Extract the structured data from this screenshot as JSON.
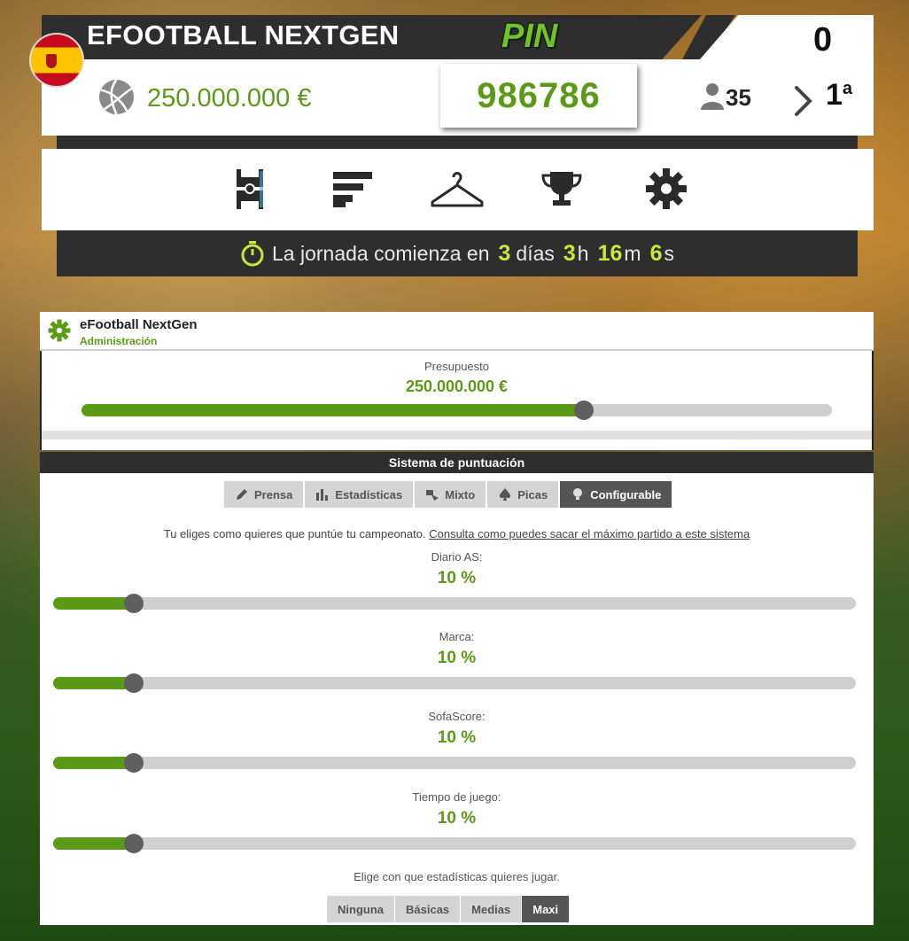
{
  "header": {
    "team_name": "EFOOTBALL NEXTGEN",
    "pin_label": "PIN",
    "points": "0",
    "budget": "250.000.000 €",
    "pin_code": "986786",
    "players_count": "35",
    "rank_number": "1",
    "rank_suffix": "a",
    "flag": "spain-flag"
  },
  "nav": {
    "items": [
      {
        "name": "lineup",
        "icon": "field-icon"
      },
      {
        "name": "ranking",
        "icon": "bars-icon"
      },
      {
        "name": "market",
        "icon": "hanger-icon"
      },
      {
        "name": "competitions",
        "icon": "trophy-icon"
      },
      {
        "name": "settings",
        "icon": "gear-icon"
      }
    ]
  },
  "countdown": {
    "prefix": "La jornada comienza en",
    "days": "3",
    "days_unit": "días",
    "hours": "3",
    "hours_unit": "h",
    "minutes": "16",
    "minutes_unit": "m",
    "seconds": "6",
    "seconds_unit": "s"
  },
  "admin": {
    "title": "eFootball NextGen",
    "subtitle": "Administración",
    "budget_label": "Presupuesto",
    "budget_value": "250.000.000 €",
    "budget_fraction": 0.67
  },
  "scoring": {
    "title": "Sistema de puntuación",
    "tabs": [
      {
        "label": "Prensa",
        "icon": "pencil-icon"
      },
      {
        "label": "Estadísticas",
        "icon": "chart-icon"
      },
      {
        "label": "Mixto",
        "icon": "mix-icon"
      },
      {
        "label": "Picas",
        "icon": "spade-icon"
      },
      {
        "label": "Configurable",
        "icon": "bulb-icon",
        "active": true
      }
    ],
    "info_text": "Tu eliges como quieres que puntúe tu campeonato.",
    "info_link": "Consulta como puedes sacar el máximo partido a este sistema",
    "sliders": [
      {
        "label": "Diario AS:",
        "value": "10 %",
        "fraction": 0.1
      },
      {
        "label": "Marca:",
        "value": "10 %",
        "fraction": 0.1
      },
      {
        "label": "SofaScore:",
        "value": "10 %",
        "fraction": 0.1
      },
      {
        "label": "Tiempo de juego:",
        "value": "10 %",
        "fraction": 0.1
      }
    ],
    "stats_label": "Elige con que estadísticas quieres jugar.",
    "stats_options": [
      {
        "label": "Ninguna"
      },
      {
        "label": "Básicas"
      },
      {
        "label": "Medias"
      },
      {
        "label": "Maxi",
        "active": true
      }
    ]
  },
  "colors": {
    "accent": "#5b9a16",
    "dark": "#2e2e2e",
    "countdown_num": "#c7e83b"
  }
}
